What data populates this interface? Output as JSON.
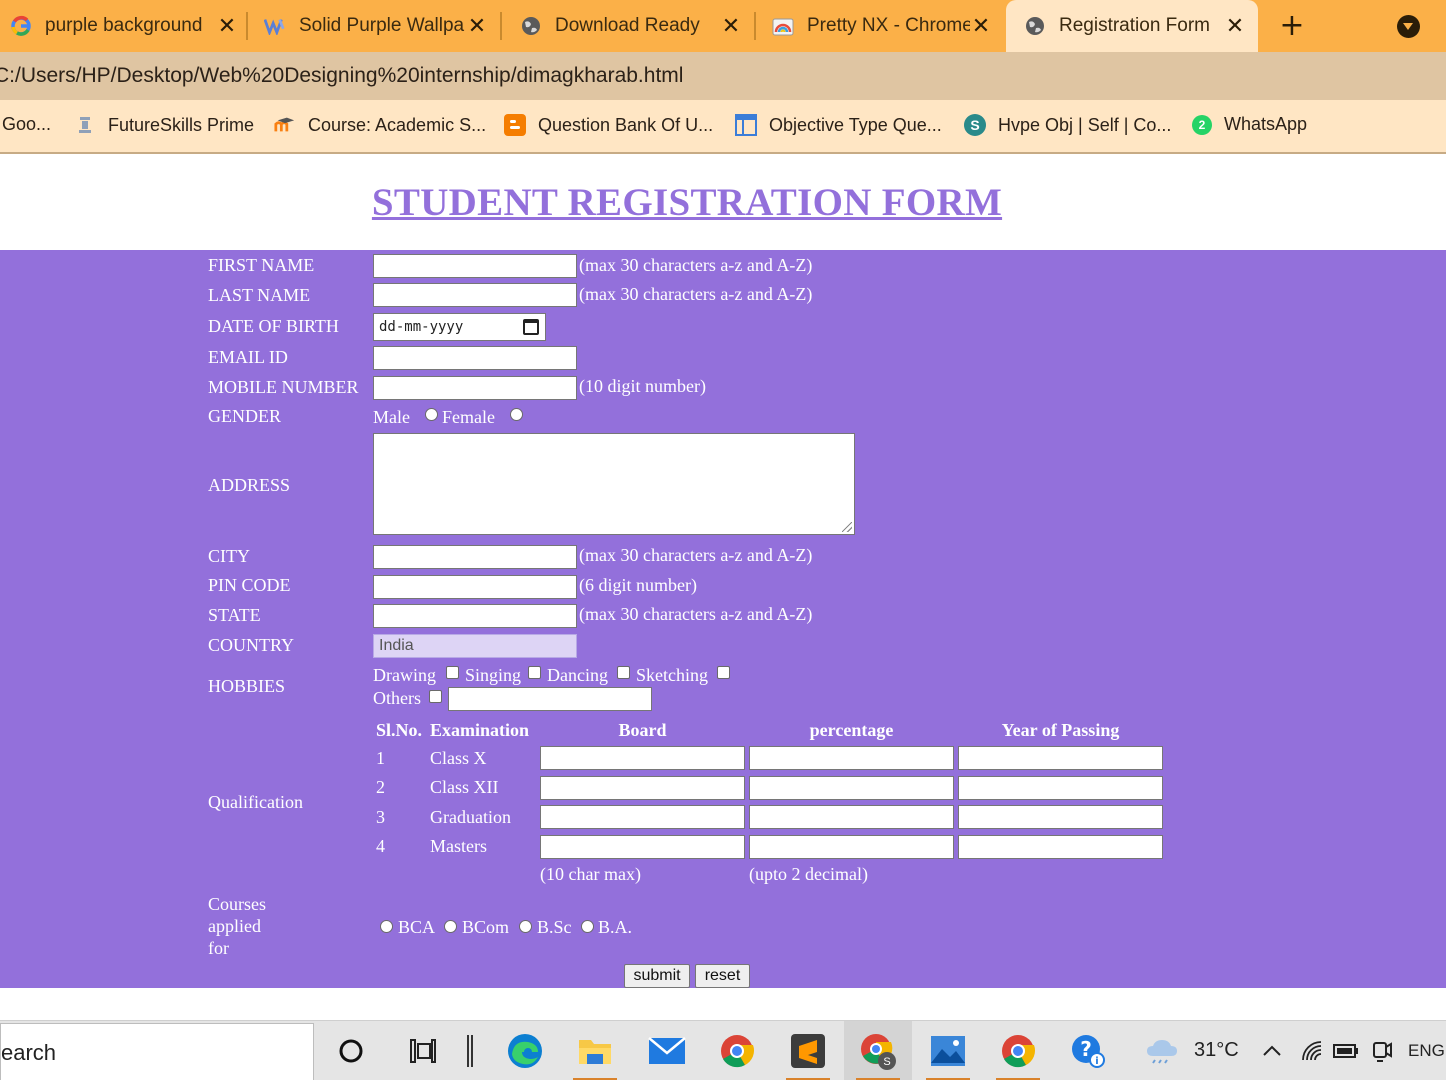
{
  "browser": {
    "tabs": [
      {
        "title": "purple background",
        "icon": "google-icon"
      },
      {
        "title": "Solid Purple Wallpa",
        "icon": "wallpaper-site-icon"
      },
      {
        "title": "Download Ready",
        "icon": "globe-icon"
      },
      {
        "title": "Pretty NX - Chrome",
        "icon": "rainbow-theme-icon"
      },
      {
        "title": "Registration Form",
        "icon": "globe-icon",
        "active": true
      }
    ],
    "new_tab_symbol": "+",
    "url": "C:/Users/HP/Desktop/Web%20Designing%20internship/dimagkharab.html",
    "bookmarks": [
      {
        "label": "Goo...",
        "icon": "google-icon"
      },
      {
        "label": "FutureSkills Prime",
        "icon": "futureskills-icon"
      },
      {
        "label": "Course: Academic S...",
        "icon": "moodle-icon"
      },
      {
        "label": "Question Bank Of U...",
        "icon": "blogger-icon"
      },
      {
        "label": "Objective Type Que...",
        "icon": "layout-icon"
      },
      {
        "label": "Hvpe Obj | Self | Co...",
        "icon": "quizlet-icon"
      },
      {
        "label": "WhatsApp",
        "icon": "whatsapp-icon"
      }
    ]
  },
  "page": {
    "title": "STUDENT REGISTRATION FORM",
    "fields": {
      "first_name": {
        "label": "FIRST NAME",
        "hint": "(max 30 characters a-z and A-Z)"
      },
      "last_name": {
        "label": "LAST NAME",
        "hint": "(max 30 characters a-z and A-Z)"
      },
      "dob": {
        "label": "DATE OF BIRTH",
        "placeholder": "dd-mm-yyyy"
      },
      "email": {
        "label": "EMAIL ID"
      },
      "mobile": {
        "label": "MOBILE NUMBER",
        "hint": "(10 digit number)"
      },
      "gender": {
        "label": "GENDER",
        "options": [
          "Male",
          "Female"
        ]
      },
      "address": {
        "label": "ADDRESS"
      },
      "city": {
        "label": "CITY",
        "hint": "(max 30 characters a-z and A-Z)"
      },
      "pin": {
        "label": "PIN CODE",
        "hint": "(6 digit number)"
      },
      "state": {
        "label": "STATE",
        "hint": "(max 30 characters a-z and A-Z)"
      },
      "country": {
        "label": "COUNTRY",
        "value": "India"
      },
      "hobbies": {
        "label": "HOBBIES",
        "options": [
          "Drawing",
          "Singing",
          "Dancing",
          "Sketching",
          "Others"
        ]
      }
    },
    "qualification": {
      "label": "Qualification",
      "headers": [
        "Sl.No.",
        "Examination",
        "Board",
        "percentage",
        "Year of Passing"
      ],
      "rows": [
        {
          "sl": "1",
          "exam": "Class X"
        },
        {
          "sl": "2",
          "exam": "Class XII"
        },
        {
          "sl": "3",
          "exam": "Graduation"
        },
        {
          "sl": "4",
          "exam": "Masters"
        }
      ],
      "board_note": "(10 char max)",
      "percentage_note": "(upto 2 decimal)"
    },
    "courses": {
      "label_lines": [
        "Courses",
        "applied",
        "for"
      ],
      "options": [
        "BCA",
        "BCom",
        "B.Sc",
        "B.A."
      ]
    },
    "buttons": {
      "submit": "submit",
      "reset": "reset"
    },
    "colors": {
      "panel": "#9370db",
      "title": "#9370db",
      "tab_strip": "#fbb048"
    }
  },
  "taskbar": {
    "search_text": "earch",
    "apps": [
      "cortana-icon",
      "task-view-icon",
      "edge-icon",
      "file-explorer-icon",
      "mail-icon",
      "chrome-icon",
      "sublime-text-icon",
      "chrome-profile-icon",
      "photos-icon",
      "chrome-icon",
      "help-icon"
    ],
    "weather": "31°C",
    "language": "ENG"
  }
}
